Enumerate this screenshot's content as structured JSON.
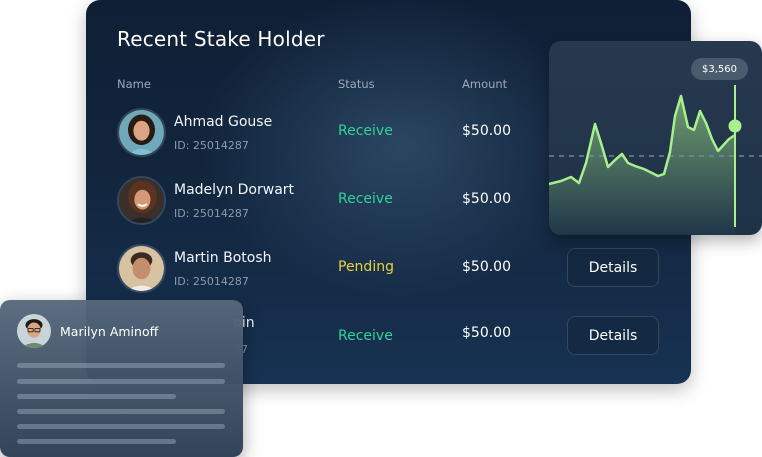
{
  "card": {
    "title": "Recent Stake Holder",
    "columns": {
      "name": "Name",
      "status": "Status",
      "amount": "Amount"
    },
    "rows": [
      {
        "name": "Ahmad Gouse",
        "id": "ID: 25014287",
        "status": "Receive",
        "amount": "$50.00"
      },
      {
        "name": "Madelyn Dorwart",
        "id": "ID: 25014287",
        "status": "Receive",
        "amount": "$50.00"
      },
      {
        "name": "Martin Botosh",
        "id": "ID: 25014287",
        "status": "Pending",
        "amount": "$50.00",
        "action": "Details"
      },
      {
        "name_fragment": "pin",
        "id_fragment": "87",
        "status": "Receive",
        "amount": "$50.00",
        "action": "Details"
      }
    ]
  },
  "chart": {
    "price_label": "$3,560",
    "colors": {
      "line": "#a8f08c",
      "dashed_line": "#7d94a8",
      "marker": "#a8f08c"
    }
  },
  "overlay": {
    "name": "Marilyn Aminoff"
  },
  "colors": {
    "receive": "#2fd29b",
    "pending": "#e8d23a"
  }
}
